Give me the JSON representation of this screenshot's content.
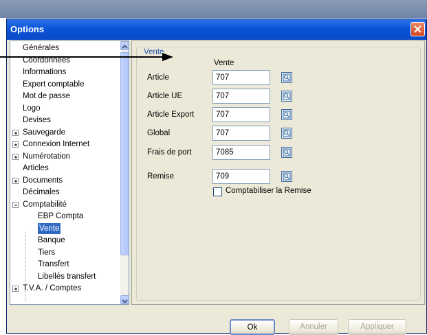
{
  "window": {
    "title": "Options"
  },
  "tree": {
    "items": [
      {
        "label": "Générales"
      },
      {
        "label": "Coordonnées"
      },
      {
        "label": "Informations"
      },
      {
        "label": "Expert comptable"
      },
      {
        "label": "Mot de passe"
      },
      {
        "label": "Logo"
      },
      {
        "label": "Devises"
      },
      {
        "label": "Sauvegarde",
        "expander": "plus"
      },
      {
        "label": "Connexion Internet",
        "expander": "plus"
      },
      {
        "label": "Numérotation",
        "expander": "plus"
      },
      {
        "label": "Articles"
      },
      {
        "label": "Documents",
        "expander": "plus"
      },
      {
        "label": "Décimales"
      },
      {
        "label": "Comptabilité",
        "expander": "minus"
      },
      {
        "label": "EBP Compta"
      },
      {
        "label": "Vente",
        "selected": true
      },
      {
        "label": "Banque"
      },
      {
        "label": "Tiers"
      },
      {
        "label": "Transfert"
      },
      {
        "label": "Libellés transfert"
      },
      {
        "label": "T.V.A. / Comptes",
        "expander": "plus"
      }
    ]
  },
  "panel": {
    "group_title": "Vente",
    "column_header": "Vente",
    "fields": [
      {
        "label": "Article",
        "value": "707"
      },
      {
        "label": "Article UE",
        "value": "707"
      },
      {
        "label": "Article Export",
        "value": "707"
      },
      {
        "label": "Global",
        "value": "707"
      },
      {
        "label": "Frais de port",
        "value": "7085"
      },
      {
        "label": "Remise",
        "value": "709"
      }
    ],
    "checkbox_label": "Comptabiliser la Remise",
    "checkbox_checked": false
  },
  "buttons": {
    "ok": "Ok",
    "cancel": "Annuler",
    "apply": "Appliquer"
  },
  "colors": {
    "titlebar": "#0a53d8",
    "selection": "#316ac5",
    "close": "#d4431b",
    "group_title": "#1f4fa8"
  }
}
